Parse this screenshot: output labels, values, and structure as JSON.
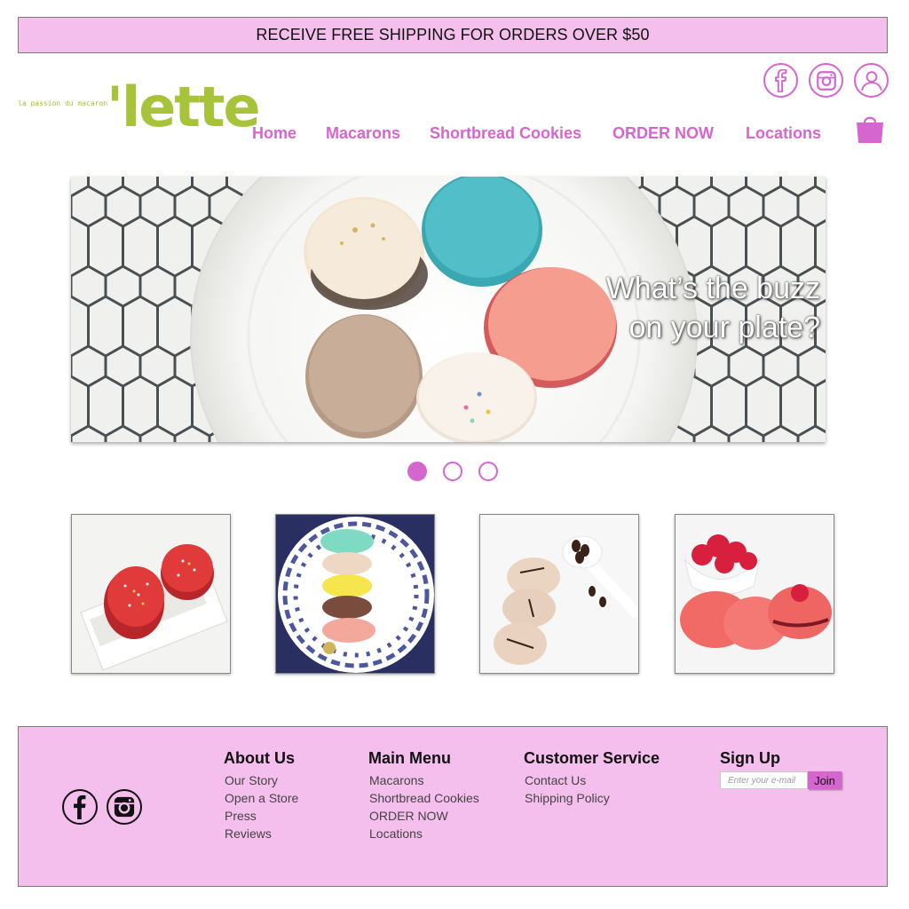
{
  "promo": {
    "text": "RECEIVE FREE SHIPPING FOR ORDERS OVER $50"
  },
  "brand": {
    "tagline": "la passion du macaron",
    "name": "'lette",
    "color": "#a6c33a"
  },
  "header": {
    "social_icons": [
      "facebook-icon",
      "instagram-icon",
      "user-account-icon"
    ],
    "cart_icon": "shopping-bag-icon"
  },
  "nav": {
    "items": [
      {
        "label": "Home"
      },
      {
        "label": "Macarons"
      },
      {
        "label": "Shortbread Cookies"
      },
      {
        "label": "ORDER NOW"
      },
      {
        "label": "Locations"
      }
    ]
  },
  "hero": {
    "caption_line1": "What’s the buzz",
    "caption_line2": "on your plate?",
    "slide_count": 3,
    "active_slide": 1
  },
  "gallery": {
    "items": [
      {
        "subject": "red sprinkle macarons in box"
      },
      {
        "subject": "stacked colorful macarons on blue plate"
      },
      {
        "subject": "coffee macarons with spoon of beans"
      },
      {
        "subject": "raspberry macarons with bowl of raspberries"
      }
    ]
  },
  "footer": {
    "columns": [
      {
        "heading": "About Us",
        "links": [
          "Our Story",
          "Open a Store",
          "Press",
          "Reviews"
        ]
      },
      {
        "heading": "Main Menu",
        "links": [
          "Macarons",
          "Shortbread Cookies",
          "ORDER NOW",
          "Locations"
        ]
      },
      {
        "heading": "Customer Service",
        "links": [
          "Contact Us",
          "Shipping Policy"
        ]
      }
    ],
    "signup": {
      "heading": "Sign Up",
      "placeholder": "Enter your e-mail",
      "button": "Join"
    },
    "social_icons": [
      "facebook-icon",
      "instagram-icon"
    ]
  },
  "colors": {
    "accent": "#d565cf",
    "banner_bg": "#f4bfec",
    "logo_green": "#a6c33a"
  }
}
